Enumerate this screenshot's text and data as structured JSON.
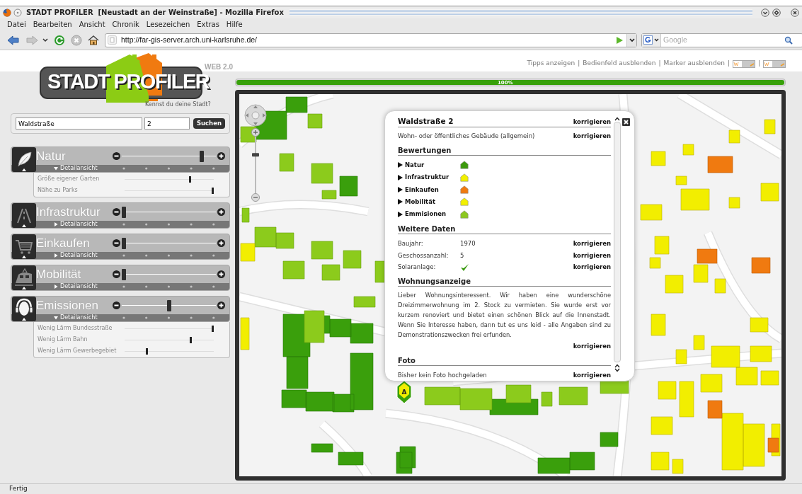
{
  "window": {
    "title": "STADT PROFILER  [Neustadt an der Weinstraße] - Mozilla Firefox"
  },
  "menu": [
    "Datei",
    "Bearbeiten",
    "Ansicht",
    "Chronik",
    "Lesezeichen",
    "Extras",
    "Hilfe"
  ],
  "navigation": {
    "url": "http://far-gis-server.arch.uni-karlsruhe.de/",
    "search_placeholder": "Google"
  },
  "logo": {
    "title": "STADT PROFILER",
    "badge": "WEB 2.0",
    "tagline": "Kennst du deine Stadt?"
  },
  "top_links": {
    "items": [
      "Tipps anzeigen",
      "Bedienfeld ausblenden",
      "Marker ausblenden"
    ],
    "separator": "|"
  },
  "search": {
    "street": "Waldstraße",
    "number": "2",
    "button": "Suchen"
  },
  "categories": [
    {
      "kind": "leaf",
      "name": "Natur",
      "level": 0.87,
      "toggle": "Detailansicht",
      "expanded": true,
      "details": [
        {
          "name": "Größe eigener Garten",
          "level": 0.74
        },
        {
          "name": "Nähe zu Parks",
          "level": 1
        }
      ]
    },
    {
      "kind": "road",
      "name": "Infrastruktur",
      "level": 0,
      "toggle": "Detailansicht",
      "expanded": false
    },
    {
      "kind": "cart",
      "name": "Einkaufen",
      "level": 0,
      "toggle": "Detailansicht",
      "expanded": false
    },
    {
      "kind": "train",
      "name": "Mobilität",
      "level": 0,
      "toggle": "Detailansicht",
      "expanded": false
    },
    {
      "kind": "headphones",
      "name": "Emissionen",
      "level": 0.5,
      "toggle": "Detailansicht",
      "expanded": true,
      "details": [
        {
          "name": "Wenig Lärm Bundesstraße",
          "level": 1
        },
        {
          "name": "Wenig Lärm Bahn",
          "level": 0.75
        },
        {
          "name": "Wenig Lärm Gewerbegebiet",
          "level": 0.24
        }
      ]
    }
  ],
  "progress": {
    "level": 1,
    "label": "100%"
  },
  "map": {
    "zoom": {
      "level": 0.72
    },
    "marker": {
      "label": "A"
    }
  },
  "popup": {
    "title": "Waldstraße 2",
    "title_action": "korrigieren",
    "type": "Wohn- oder öffentliches Gebäude (allgemein)",
    "type_action": "korrigieren",
    "sections": [
      {
        "kind": "ratings",
        "heading": "Bewertungen",
        "items": [
          {
            "name": "Natur",
            "color": "#3c9a0c"
          },
          {
            "name": "Infrastruktur",
            "color": "#f2f000"
          },
          {
            "name": "Einkaufen",
            "color": "#f07a10"
          },
          {
            "name": "Mobilität",
            "color": "#f2f000"
          },
          {
            "name": "Emmisionen",
            "color": "#8cc820"
          }
        ]
      },
      {
        "kind": "data",
        "heading": "Weitere Daten",
        "rows": [
          {
            "kind": "text",
            "label": "Baujahr:",
            "value": "1970",
            "action": "korrigieren"
          },
          {
            "kind": "text",
            "label": "Geschossanzahl:",
            "value": "5",
            "action": "korrigieren"
          },
          {
            "kind": "check",
            "label": "Solaranlage:",
            "checked": true,
            "action": "korrigieren"
          }
        ]
      },
      {
        "kind": "text",
        "heading": "Wohnungsanzeige",
        "text": "Lieber Wohnungsinteressent. Wir haben eine wunderschöne Dreizimmerwohnung im 2. Stock zu vermieten. Sie wurde erst vor kurzem renoviert und bietet einen schönen Blick auf die Innenstadt. Wenn Sie Interesse haben, dann tut es uns leid - alle Angaben sind zu Demonstrationszwecken frei erfunden.",
        "action": "korrigieren"
      },
      {
        "kind": "inline",
        "heading": "Foto",
        "text": "Bisher kein Foto hochgeladen",
        "action": "korrigieren"
      }
    ]
  },
  "status_bar": "Fertig"
}
